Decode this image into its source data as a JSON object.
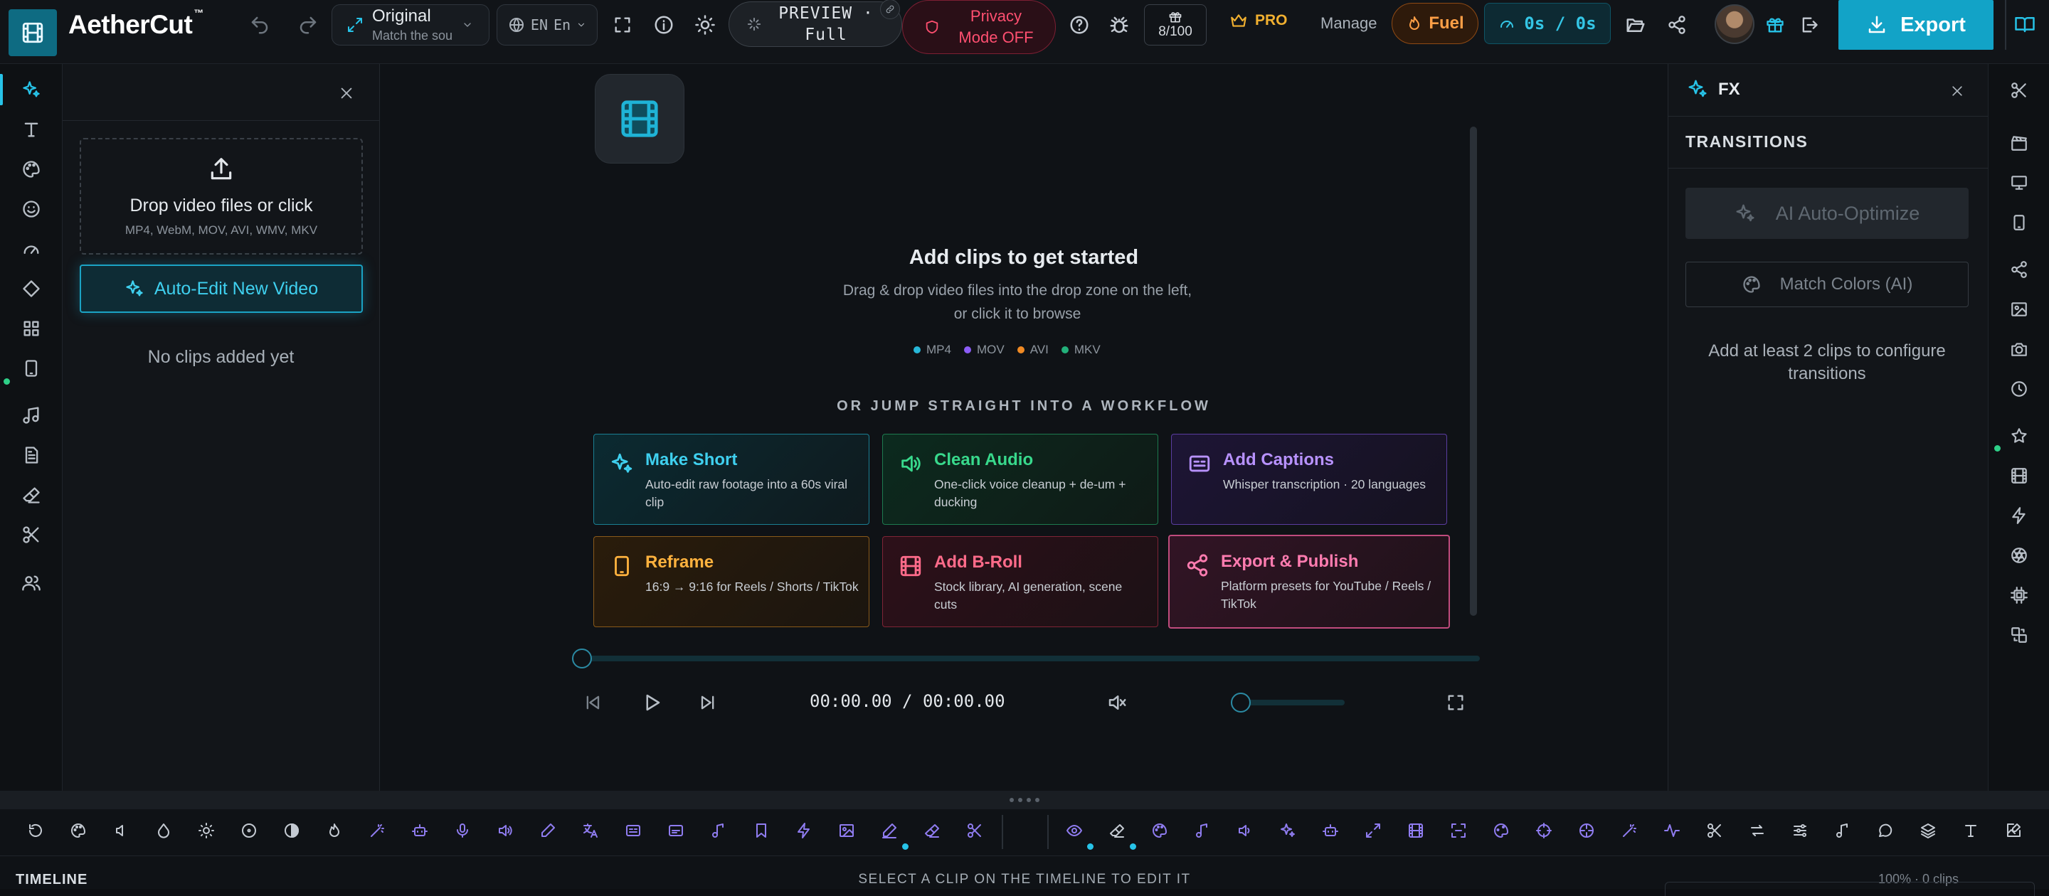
{
  "app": {
    "name": "AetherCut",
    "trademark": "™"
  },
  "topbar": {
    "preset_title": "Original",
    "preset_sub": "Match the sou",
    "lang_code": "EN",
    "lang_name": "En",
    "preview_line1": "PREVIEW ·",
    "preview_line2": "Full",
    "privacy_line1": "Privacy",
    "privacy_line2": "Mode OFF",
    "credits": "8/100",
    "pro_label": "PRO",
    "manage_label": "Manage",
    "fuel_label": "Fuel",
    "timer": "0s / 0s",
    "export_label": "Export"
  },
  "left_panel": {
    "drop_title": "Drop video files or click",
    "drop_formats": "MP4, WebM, MOV, AVI, WMV, MKV",
    "auto_edit_label": "Auto-Edit New Video",
    "empty_label": "No clips added yet"
  },
  "stage": {
    "title": "Add clips to get started",
    "subtitle": "Drag & drop video files into the drop zone on the left, or click it to browse",
    "formats": [
      {
        "label": "MP4",
        "color": "#27b7d8"
      },
      {
        "label": "MOV",
        "color": "#8b5cf6"
      },
      {
        "label": "AVI",
        "color": "#f08a24"
      },
      {
        "label": "MKV",
        "color": "#22b07a"
      }
    ],
    "workflow_heading": "OR JUMP STRAIGHT INTO A WORKFLOW",
    "workflows": [
      {
        "title": "Make Short",
        "desc": "Auto-edit raw footage into a 60s viral clip"
      },
      {
        "title": "Clean Audio",
        "desc": "One-click voice cleanup + de-um + ducking"
      },
      {
        "title": "Add Captions",
        "desc": "Whisper transcription · 20 languages"
      },
      {
        "title": "Reframe",
        "desc": "16:9 → 9:16 for Reels / Shorts / TikTok"
      },
      {
        "title": "Add B-Roll",
        "desc": "Stock library, AI generation, scene cuts"
      },
      {
        "title": "Export & Publish",
        "desc": "Platform presets for YouTube / Reels / TikTok"
      }
    ],
    "time_display": "00:00.00 / 00:00.00"
  },
  "fx_panel": {
    "title": "FX",
    "section": "TRANSITIONS",
    "ai_optimize_label": "AI Auto-Optimize",
    "match_colors_label": "Match Colors (AI)",
    "note": "Add at least 2 clips to configure transitions"
  },
  "timeline": {
    "label": "TIMELINE",
    "hint": "SELECT A CLIP ON THE TIMELINE TO EDIT IT",
    "status": "100%  ·  0 clips"
  }
}
